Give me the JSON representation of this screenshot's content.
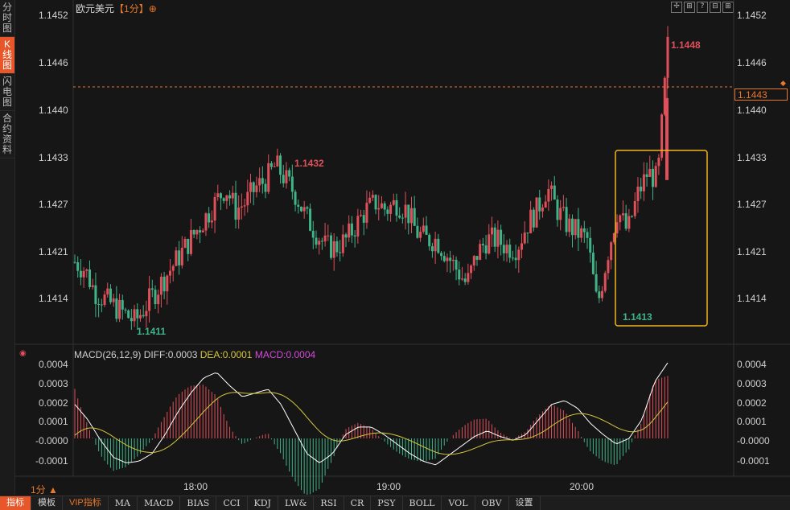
{
  "sidebar": {
    "tabs": [
      {
        "label": "分时图",
        "chars": [
          "分",
          "时",
          "图"
        ],
        "active": false
      },
      {
        "label": "K线图",
        "chars": [
          "K",
          "线",
          "图"
        ],
        "active": true
      },
      {
        "label": "闪电图",
        "chars": [
          "闪",
          "电",
          "图"
        ],
        "active": false
      },
      {
        "label": "合约资料",
        "chars": [
          "合",
          "约",
          "资",
          "料"
        ],
        "active": false
      }
    ]
  },
  "header": {
    "instrument": "欧元美元",
    "period": "【1分】",
    "add_icon": "⊕"
  },
  "toolbar": {
    "icons": [
      "crosshair-icon",
      "expand-icon",
      "help-icon",
      "zoom-out-icon",
      "zoom-in-icon"
    ],
    "glyphs": [
      "✢",
      "⊞",
      "?",
      "⊟",
      "⊞"
    ]
  },
  "price_axis": {
    "labels": [
      "1.1452",
      "1.1446",
      "1.1440",
      "1.1433",
      "1.1427",
      "1.1421",
      "1.1414"
    ]
  },
  "current_price": "1.1443",
  "annotations": {
    "high_1": "1.1432",
    "low_1": "1.1411",
    "low_2": "1.1413",
    "high_2": "1.1448"
  },
  "macd": {
    "name": "MACD(26,12,9)",
    "diff": "DIFF:0.0003",
    "dea": "DEA:0.0001",
    "macd": "MACD:0.0004",
    "axis_labels": [
      "0.0004",
      "0.0003",
      "0.0002",
      "0.0001",
      "-0.0000",
      "-0.0001"
    ]
  },
  "time_axis": {
    "period_label": "1分 ▲",
    "labels": [
      "18:00",
      "19:00",
      "20:00"
    ]
  },
  "bottom_bar": {
    "items": [
      "指标",
      "模板",
      "VIP指标",
      "MA",
      "MACD",
      "BIAS",
      "CCI",
      "KDJ",
      "LW&",
      "RSI",
      "CR",
      "PSY",
      "BOLL",
      "VOL",
      "OBV",
      "设置"
    ]
  },
  "colors": {
    "up": "#e0505a",
    "down": "#3fb489",
    "diff": "#ffffff",
    "dea": "#d4c63a",
    "accent": "#e8572a",
    "highlight_box": "#f2b41c",
    "current_line": "#e8782a"
  },
  "chart_data": {
    "type": "candlestick",
    "title": "欧元美元 1分",
    "ylim": [
      1.1409,
      1.1453
    ],
    "x_ticks": [
      "18:00",
      "19:00",
      "20:00"
    ],
    "close_path": [
      1.1419,
      1.1418,
      1.1415,
      1.1414,
      1.1413,
      1.1412,
      1.1411,
      1.1413,
      1.1415,
      1.1417,
      1.1419,
      1.1421,
      1.1423,
      1.1425,
      1.1427,
      1.1429,
      1.1426,
      1.1427,
      1.1429,
      1.143,
      1.1432,
      1.143,
      1.1428,
      1.1425,
      1.1423,
      1.1421,
      1.1421,
      1.1422,
      1.1424,
      1.1426,
      1.1427,
      1.1426,
      1.1427,
      1.1426,
      1.1423,
      1.1422,
      1.1422,
      1.142,
      1.1418,
      1.1416,
      1.142,
      1.1422,
      1.1422,
      1.1421,
      1.1421,
      1.1424,
      1.1426,
      1.1429,
      1.1426,
      1.1424,
      1.1423,
      1.1422,
      1.1413,
      1.142,
      1.1426,
      1.1423,
      1.1428,
      1.1431,
      1.143,
      1.1448
    ],
    "macd_diff_path": [
      0.00018,
      0.0001,
      -1e-05,
      -0.0001,
      -0.00013,
      -0.00012,
      -8e-05,
      2e-05,
      0.00014,
      0.00024,
      0.00032,
      0.00035,
      0.00028,
      0.00022,
      0.00024,
      0.00026,
      0.00018,
      5e-05,
      -8e-05,
      -0.00013,
      -8e-05,
      2e-05,
      6e-05,
      6e-05,
      2e-05,
      -3e-05,
      -8e-05,
      -0.00012,
      -0.00014,
      -9e-05,
      -4e-05,
      1e-05,
      4e-05,
      1e-05,
      -1e-05,
      2e-05,
      0.0001,
      0.00018,
      0.0002,
      0.00016,
      8e-05,
      2e-05,
      -3e-05,
      0.0,
      0.0001,
      0.0003,
      0.0004
    ]
  }
}
